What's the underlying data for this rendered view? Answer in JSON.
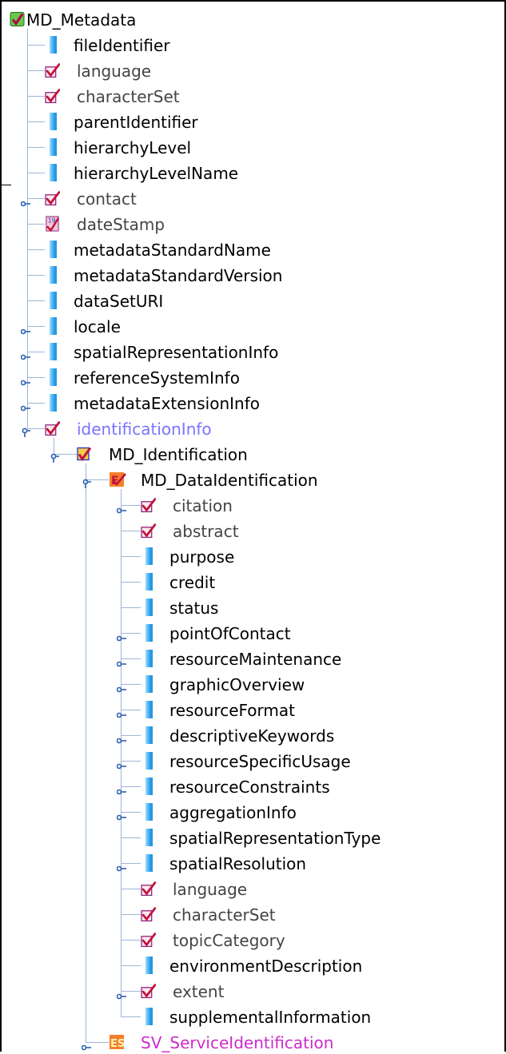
{
  "tree": {
    "nodes": [
      {
        "label": "MD_Metadata",
        "icon": "metadata-root-icon",
        "level": 0,
        "style": "normal",
        "expander": "none",
        "connector": "none"
      },
      {
        "label": "fileIdentifier",
        "icon": "property-bar-icon",
        "level": 1,
        "style": "normal",
        "expander": "none",
        "connector": "line"
      },
      {
        "label": "language",
        "icon": "codelist-check-icon",
        "level": 1,
        "style": "optional",
        "expander": "none",
        "connector": "line"
      },
      {
        "label": "characterSet",
        "icon": "codelist-check-icon",
        "level": 1,
        "style": "optional",
        "expander": "none",
        "connector": "line"
      },
      {
        "label": "parentIdentifier",
        "icon": "property-bar-icon",
        "level": 1,
        "style": "normal",
        "expander": "none",
        "connector": "line"
      },
      {
        "label": "hierarchyLevel",
        "icon": "property-bar-icon",
        "level": 1,
        "style": "normal",
        "expander": "none",
        "connector": "line"
      },
      {
        "label": "hierarchyLevelName",
        "icon": "property-bar-icon",
        "level": 1,
        "style": "normal",
        "expander": "none",
        "connector": "line"
      },
      {
        "label": "contact",
        "icon": "codelist-check-icon",
        "level": 1,
        "style": "optional",
        "expander": "collapsed",
        "connector": "line"
      },
      {
        "label": "dateStamp",
        "icon": "calendar-icon",
        "level": 1,
        "style": "optional",
        "expander": "none",
        "connector": "line"
      },
      {
        "label": "metadataStandardName",
        "icon": "property-bar-icon",
        "level": 1,
        "style": "normal",
        "expander": "none",
        "connector": "line"
      },
      {
        "label": "metadataStandardVersion",
        "icon": "property-bar-icon",
        "level": 1,
        "style": "normal",
        "expander": "none",
        "connector": "line"
      },
      {
        "label": "dataSetURI",
        "icon": "property-bar-icon",
        "level": 1,
        "style": "normal",
        "expander": "none",
        "connector": "line"
      },
      {
        "label": "locale",
        "icon": "property-bar-icon",
        "level": 1,
        "style": "normal",
        "expander": "collapsed",
        "connector": "line"
      },
      {
        "label": "spatialRepresentationInfo",
        "icon": "property-bar-icon",
        "level": 1,
        "style": "normal",
        "expander": "collapsed",
        "connector": "line"
      },
      {
        "label": "referenceSystemInfo",
        "icon": "property-bar-icon",
        "level": 1,
        "style": "normal",
        "expander": "collapsed",
        "connector": "line"
      },
      {
        "label": "metadataExtensionInfo",
        "icon": "property-bar-icon",
        "level": 1,
        "style": "normal",
        "expander": "collapsed",
        "connector": "line"
      },
      {
        "label": "identificationInfo",
        "icon": "codelist-check-icon",
        "level": 1,
        "style": "highlight",
        "expander": "expanded",
        "connector": "line"
      },
      {
        "label": "MD_Identification",
        "icon": "identification-icon",
        "level": 2,
        "style": "normal",
        "expander": "expanded",
        "connector": "line"
      },
      {
        "label": "MD_DataIdentification",
        "icon": "data-identification-icon",
        "level": 3,
        "style": "normal",
        "expander": "expanded",
        "connector": "line"
      },
      {
        "label": "citation",
        "icon": "codelist-check-icon",
        "level": 4,
        "style": "optional",
        "expander": "collapsed",
        "connector": "line"
      },
      {
        "label": "abstract",
        "icon": "codelist-check-icon",
        "level": 4,
        "style": "optional",
        "expander": "none",
        "connector": "line"
      },
      {
        "label": "purpose",
        "icon": "property-bar-icon",
        "level": 4,
        "style": "normal",
        "expander": "none",
        "connector": "line"
      },
      {
        "label": "credit",
        "icon": "property-bar-icon",
        "level": 4,
        "style": "normal",
        "expander": "none",
        "connector": "line"
      },
      {
        "label": "status",
        "icon": "property-bar-icon",
        "level": 4,
        "style": "normal",
        "expander": "none",
        "connector": "line"
      },
      {
        "label": "pointOfContact",
        "icon": "property-bar-icon",
        "level": 4,
        "style": "normal",
        "expander": "collapsed",
        "connector": "line"
      },
      {
        "label": "resourceMaintenance",
        "icon": "property-bar-icon",
        "level": 4,
        "style": "normal",
        "expander": "collapsed",
        "connector": "line"
      },
      {
        "label": "graphicOverview",
        "icon": "property-bar-icon",
        "level": 4,
        "style": "normal",
        "expander": "collapsed",
        "connector": "line"
      },
      {
        "label": "resourceFormat",
        "icon": "property-bar-icon",
        "level": 4,
        "style": "normal",
        "expander": "collapsed",
        "connector": "line"
      },
      {
        "label": "descriptiveKeywords",
        "icon": "property-bar-icon",
        "level": 4,
        "style": "normal",
        "expander": "collapsed",
        "connector": "line"
      },
      {
        "label": "resourceSpecificUsage",
        "icon": "property-bar-icon",
        "level": 4,
        "style": "normal",
        "expander": "collapsed",
        "connector": "line"
      },
      {
        "label": "resourceConstraints",
        "icon": "property-bar-icon",
        "level": 4,
        "style": "normal",
        "expander": "collapsed",
        "connector": "line"
      },
      {
        "label": "aggregationInfo",
        "icon": "property-bar-icon",
        "level": 4,
        "style": "normal",
        "expander": "collapsed",
        "connector": "line"
      },
      {
        "label": "spatialRepresentationType",
        "icon": "property-bar-icon",
        "level": 4,
        "style": "normal",
        "expander": "none",
        "connector": "line"
      },
      {
        "label": "spatialResolution",
        "icon": "property-bar-icon",
        "level": 4,
        "style": "normal",
        "expander": "collapsed",
        "connector": "line"
      },
      {
        "label": "language",
        "icon": "codelist-check-icon",
        "level": 4,
        "style": "optional",
        "expander": "none",
        "connector": "line"
      },
      {
        "label": "characterSet",
        "icon": "codelist-check-icon",
        "level": 4,
        "style": "optional",
        "expander": "none",
        "connector": "line"
      },
      {
        "label": "topicCategory",
        "icon": "codelist-check-icon",
        "level": 4,
        "style": "optional",
        "expander": "none",
        "connector": "line"
      },
      {
        "label": "environmentDescription",
        "icon": "property-bar-icon",
        "level": 4,
        "style": "normal",
        "expander": "none",
        "connector": "line"
      },
      {
        "label": "extent",
        "icon": "codelist-check-icon",
        "level": 4,
        "style": "optional",
        "expander": "collapsed",
        "connector": "line"
      },
      {
        "label": "supplementalInformation",
        "icon": "property-bar-icon",
        "level": 4,
        "style": "normal",
        "expander": "none",
        "connector": "line"
      },
      {
        "label": "SV_ServiceIdentification",
        "icon": "service-identification-icon",
        "level": 3,
        "style": "service",
        "expander": "collapsed",
        "connector": "line"
      }
    ]
  },
  "colors": {
    "tree_line": "#9db5d8",
    "check_red": "#c0123b",
    "check_purple": "#8d1f7a",
    "highlight_text": "#7a74ff",
    "service_text": "#cc2ccc",
    "bar_blue": "#2ea2ec"
  }
}
